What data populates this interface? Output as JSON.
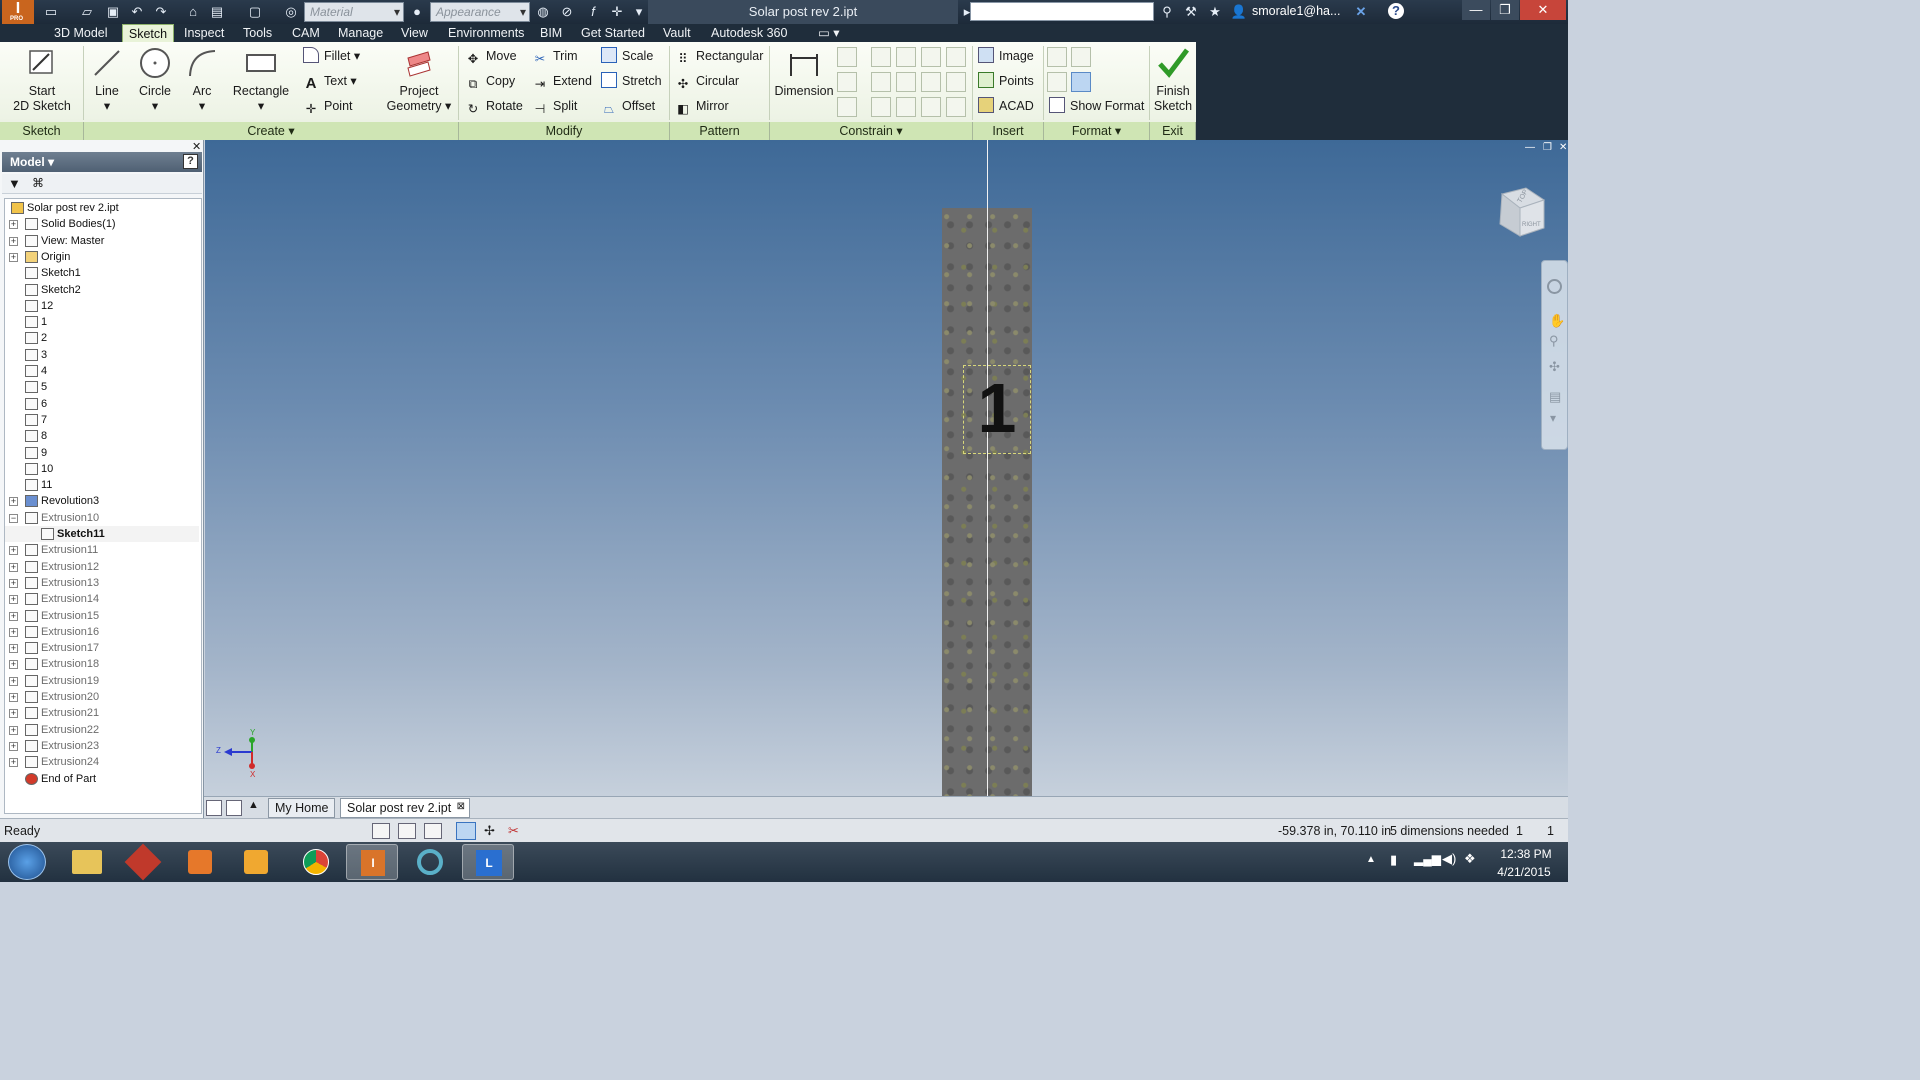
{
  "app": {
    "title": "Solar post rev 2.ipt",
    "badge": "PRO"
  },
  "quick_access": {
    "material_placeholder": "Material",
    "appearance_placeholder": "Appearance",
    "fx": "f",
    "user": "smorale1@ha..."
  },
  "menu_tabs": [
    "3D Model",
    "Sketch",
    "Inspect",
    "Tools",
    "CAM",
    "Manage",
    "View",
    "Environments",
    "BIM",
    "Get Started",
    "Vault",
    "Autodesk 360"
  ],
  "active_tab": "Sketch",
  "ribbon": {
    "sketch_panel": {
      "label": "Sketch",
      "start_line1": "Start",
      "start_line2": "2D Sketch"
    },
    "create_panel": {
      "label": "Create",
      "line": "Line",
      "circle": "Circle",
      "arc": "Arc",
      "rectangle": "Rectangle",
      "fillet": "Fillet",
      "text": "Text",
      "point": "Point",
      "project_line1": "Project",
      "project_line2": "Geometry"
    },
    "modify_panel": {
      "label": "Modify",
      "move": "Move",
      "copy": "Copy",
      "rotate": "Rotate",
      "trim": "Trim",
      "extend": "Extend",
      "split": "Split",
      "scale": "Scale",
      "stretch": "Stretch",
      "offset": "Offset"
    },
    "pattern_panel": {
      "label": "Pattern",
      "rectangular": "Rectangular",
      "circular": "Circular",
      "mirror": "Mirror"
    },
    "constrain_panel": {
      "label": "Constrain",
      "dimension": "Dimension"
    },
    "insert_panel": {
      "label": "Insert",
      "image": "Image",
      "points": "Points",
      "acad": "ACAD"
    },
    "format_panel": {
      "label": "Format",
      "show_format": "Show Format"
    },
    "exit_panel": {
      "label": "Exit",
      "finish_line1": "Finish",
      "finish_line2": "Sketch"
    }
  },
  "browser": {
    "title": "Model",
    "nodes": [
      {
        "label": "Solar post rev 2.ipt"
      },
      {
        "label": "Solid Bodies(1)"
      },
      {
        "label": "View: Master"
      },
      {
        "label": "Origin"
      },
      {
        "label": "Sketch1"
      },
      {
        "label": "Sketch2"
      },
      {
        "label": "12"
      },
      {
        "label": "1"
      },
      {
        "label": "2"
      },
      {
        "label": "3"
      },
      {
        "label": "4"
      },
      {
        "label": "5"
      },
      {
        "label": "6"
      },
      {
        "label": "7"
      },
      {
        "label": "8"
      },
      {
        "label": "9"
      },
      {
        "label": "10"
      },
      {
        "label": "11"
      },
      {
        "label": "Revolution3"
      },
      {
        "label": "Extrusion10"
      },
      {
        "label": "Sketch11"
      },
      {
        "label": "Extrusion11"
      },
      {
        "label": "Extrusion12"
      },
      {
        "label": "Extrusion13"
      },
      {
        "label": "Extrusion14"
      },
      {
        "label": "Extrusion15"
      },
      {
        "label": "Extrusion16"
      },
      {
        "label": "Extrusion17"
      },
      {
        "label": "Extrusion18"
      },
      {
        "label": "Extrusion19"
      },
      {
        "label": "Extrusion20"
      },
      {
        "label": "Extrusion21"
      },
      {
        "label": "Extrusion22"
      },
      {
        "label": "Extrusion23"
      },
      {
        "label": "Extrusion24"
      },
      {
        "label": "End of Part"
      }
    ]
  },
  "viewport": {
    "sketch_text": "1",
    "viewcube_top": "TOP",
    "viewcube_right": "RIGHT",
    "axis_x": "X",
    "axis_y": "Y",
    "axis_z": "Z"
  },
  "doc_tabs": [
    "My Home",
    "Solar post rev 2.ipt"
  ],
  "status": {
    "left": "Ready",
    "coords": "-59.378 in, 70.110 in",
    "dims": "5 dimensions needed",
    "n1": "1",
    "n2": "1"
  },
  "taskbar": {
    "time": "12:38 PM",
    "date": "4/21/2015"
  },
  "colors": {
    "ribbon_panel": "#cfe5b4",
    "active_tab": "#e9f3d9",
    "viewport_top": "#3e6997",
    "viewport_bottom": "#c6d0dc"
  }
}
